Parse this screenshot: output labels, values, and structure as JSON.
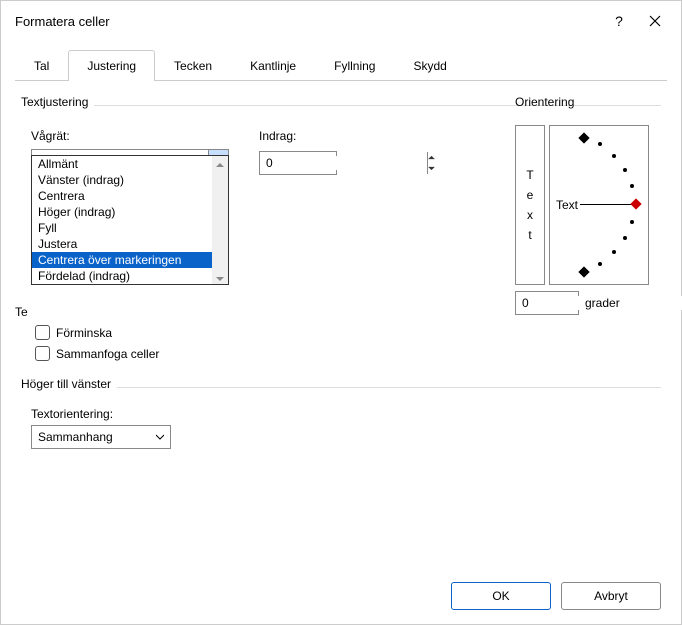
{
  "window": {
    "title": "Formatera celler"
  },
  "tabs": {
    "items": [
      "Tal",
      "Justering",
      "Tecken",
      "Kantlinje",
      "Fyllning",
      "Skydd"
    ],
    "active": "Justering"
  },
  "textAlign": {
    "group": "Textjustering",
    "horizLabel": "Vågrät:",
    "horizValue": "Allmänt",
    "indentLabel": "Indrag:",
    "indentValue": "0",
    "options": [
      "Allmänt",
      "Vänster (indrag)",
      "Centrera",
      "Höger (indrag)",
      "Fyll",
      "Justera",
      "Centrera över markeringen",
      "Fördelad (indrag)"
    ],
    "highlighted": "Centrera över markeringen"
  },
  "textCtrl": {
    "prefix": "Te",
    "shrink": "Förminska",
    "merge": "Sammanfoga celler"
  },
  "rtl": {
    "group": "Höger till vänster",
    "dirLabel": "Textorientering:",
    "dirValue": "Sammanhang"
  },
  "orient": {
    "group": "Orientering",
    "vertical": "Text",
    "label": "Text",
    "degValue": "0",
    "degLabel": "grader"
  },
  "buttons": {
    "ok": "OK",
    "cancel": "Avbryt"
  }
}
